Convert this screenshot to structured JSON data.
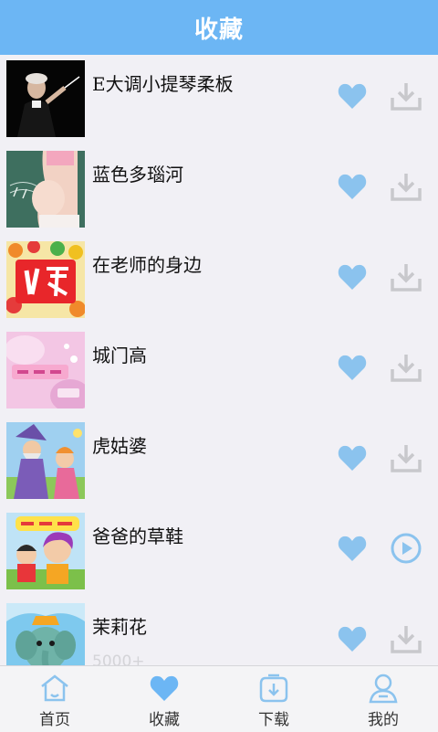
{
  "header": {
    "title": "收藏"
  },
  "colors": {
    "accent": "#6cb6f4",
    "icon_blue": "#8bc3ee",
    "icon_gray": "#c8c8cc"
  },
  "items": [
    {
      "title": "E大调小提琴柔板",
      "thumb": "conductor-photo",
      "action": "download-icon"
    },
    {
      "title": "蓝色多瑙河",
      "thumb": "pregnant-belly-photo",
      "action": "download-icon"
    },
    {
      "title": "在老师的身边",
      "thumb": "erge-cover",
      "action": "download-icon"
    },
    {
      "title": "城门高",
      "thumb": "pink-cover",
      "action": "download-icon"
    },
    {
      "title": "虎姑婆",
      "thumb": "wizard-cartoon",
      "action": "download-icon"
    },
    {
      "title": "爸爸的草鞋",
      "thumb": "kids-cartoon",
      "action": "play-icon"
    },
    {
      "title": "茉莉花",
      "thumb": "elephant-cartoon",
      "action": "download-icon",
      "overlay": "5000+"
    }
  ],
  "tabs": [
    {
      "label": "首页",
      "icon": "home-icon"
    },
    {
      "label": "收藏",
      "icon": "heart-icon"
    },
    {
      "label": "下载",
      "icon": "download-box-icon"
    },
    {
      "label": "我的",
      "icon": "person-icon"
    }
  ]
}
